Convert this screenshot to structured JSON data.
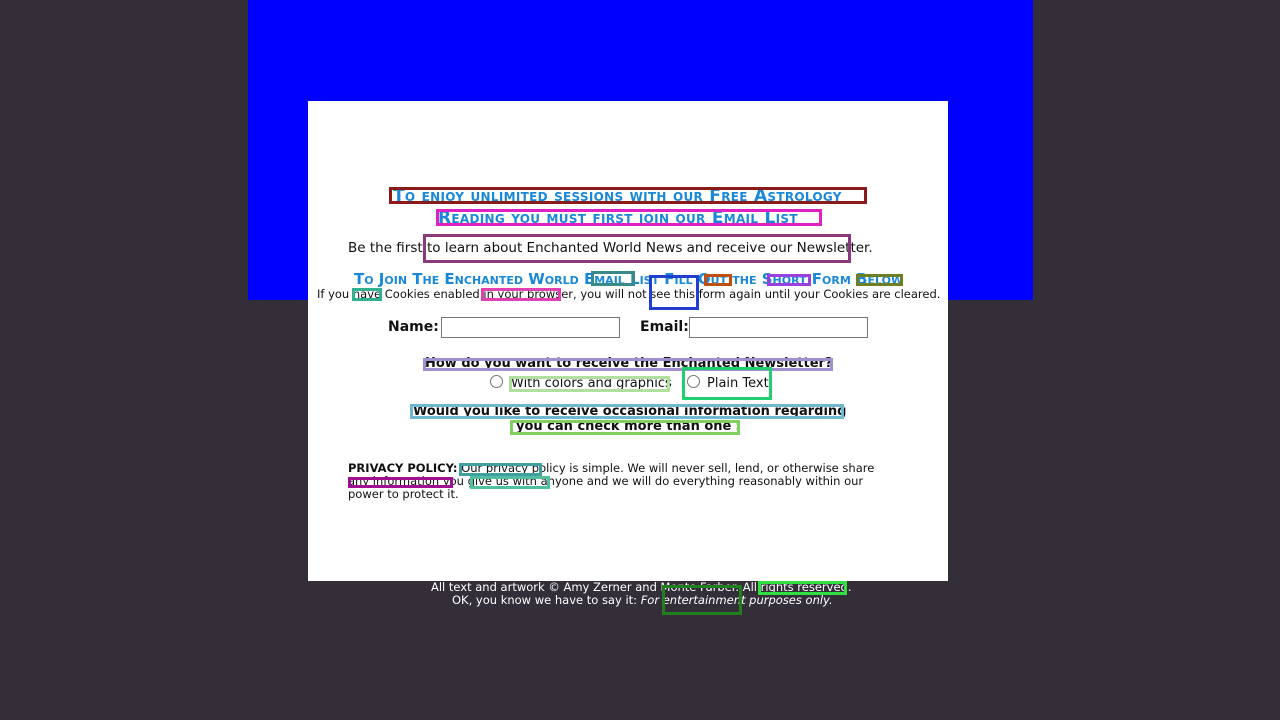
{
  "heading": {
    "line1": "To enjoy unlimited sessions with our Free Astrology",
    "line2": "Reading you must first join our Email List"
  },
  "intro": "Be the first to learn about Enchanted World News and receive our Newsletter.",
  "join_heading": "To Join The Enchanted World Email List Fill Out the Short Form Below",
  "cookie_note": "If you have Cookies enabled in your browser, you will not see this form again until your Cookies are cleared.",
  "form": {
    "name_label": "Name:",
    "email_label": "Email:",
    "name_value": "",
    "email_value": "",
    "format_question": "How do you want to receive the Enchanted Newsletter?",
    "option_graphics": "With colors and graphics",
    "option_plain": "Plain Text",
    "interests_question": "Would you like to receive occasional information regarding",
    "interests_note": "you can check more than one",
    "interests_colon": ":"
  },
  "privacy": {
    "label": "PRIVACY POLICY:",
    "text": "Our privacy policy is simple. We will never sell, lend, or otherwise share any information you give us with anyone and we will do everything reasonably within our power to protect it."
  },
  "footer": {
    "copyright": "All text and artwork © Amy Zerner and Monte Farber. All rights reserved.",
    "disclaimer_prefix": "OK, you know we have to say it: ",
    "disclaimer_italic": "For entertainment purposes only."
  },
  "colors": {
    "page_background": "#332e38",
    "banner": "#0000ff",
    "panel": "#ffffff",
    "heading": "#1a88d8"
  }
}
